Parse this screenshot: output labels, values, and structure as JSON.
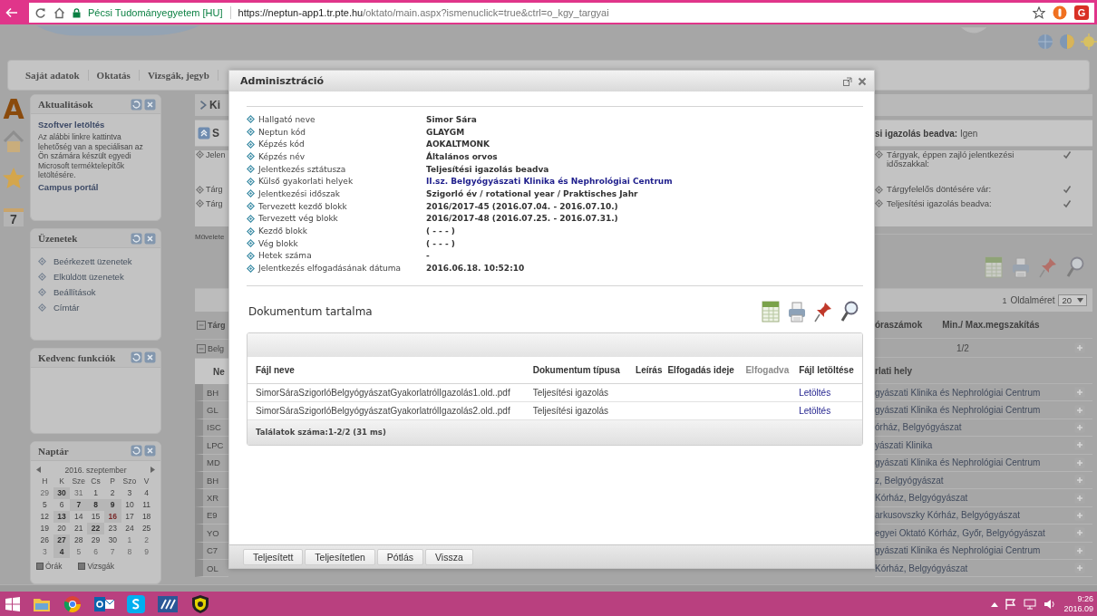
{
  "browser": {
    "site": "Pécsi Tudományegyetem [HU]",
    "url_host": "https://neptun-app1.tr.pte.hu",
    "url_path": "/oktato/main.aspx?ismenuclick=true&ctrl=o_kgy_targyai",
    "extension_letter": "G"
  },
  "nav_menu": [
    {
      "label": "Saját adatok"
    },
    {
      "label": "Oktatás"
    },
    {
      "label": "Vizsgák, jegyb"
    }
  ],
  "side_strip": {
    "logo_letter": "A",
    "calendar_day": "7"
  },
  "news_panel": {
    "title": "Aktualitások",
    "heading": "Szoftver letöltés",
    "text": "Az alábbi linkre kattintva lehetőség van a speciálisan az Ön számára készült egyedi Microsoft terméktelepítők letöltésére.",
    "link": "Campus portál"
  },
  "messages_panel": {
    "title": "Üzenetek",
    "items": [
      "Beérkezett üzenetek",
      "Elküldött üzenetek",
      "Beállítások",
      "Címtár"
    ]
  },
  "favorites_panel": {
    "title": "Kedvenc funkciók"
  },
  "calendar_panel": {
    "title": "Naptár",
    "month": "2016. szeptember",
    "weekdays": [
      "H",
      "K",
      "Sze",
      "Cs",
      "P",
      "Szo",
      "V"
    ],
    "weeks": [
      [
        {
          "day": "29",
          "muted": true,
          "bold": false,
          "today": false
        },
        {
          "day": "30",
          "muted": true,
          "bold": true,
          "today": false
        },
        {
          "day": "31",
          "muted": true,
          "bold": false,
          "today": false
        },
        {
          "day": "1",
          "muted": false,
          "bold": false,
          "today": false
        },
        {
          "day": "2",
          "muted": false,
          "bold": false,
          "today": false
        },
        {
          "day": "3",
          "muted": false,
          "bold": false,
          "today": false
        },
        {
          "day": "4",
          "muted": false,
          "bold": false,
          "today": false
        }
      ],
      [
        {
          "day": "5",
          "muted": false,
          "bold": false,
          "today": false
        },
        {
          "day": "6",
          "muted": false,
          "bold": false,
          "today": false
        },
        {
          "day": "7",
          "muted": false,
          "bold": true,
          "today": false
        },
        {
          "day": "8",
          "muted": false,
          "bold": true,
          "today": false
        },
        {
          "day": "9",
          "muted": false,
          "bold": true,
          "today": false
        },
        {
          "day": "10",
          "muted": false,
          "bold": false,
          "today": false
        },
        {
          "day": "11",
          "muted": false,
          "bold": false,
          "today": false
        }
      ],
      [
        {
          "day": "12",
          "muted": false,
          "bold": false,
          "today": false
        },
        {
          "day": "13",
          "muted": false,
          "bold": true,
          "today": false
        },
        {
          "day": "14",
          "muted": false,
          "bold": false,
          "today": false
        },
        {
          "day": "15",
          "muted": false,
          "bold": false,
          "today": false
        },
        {
          "day": "16",
          "muted": false,
          "bold": true,
          "today": true
        },
        {
          "day": "17",
          "muted": false,
          "bold": false,
          "today": false
        },
        {
          "day": "18",
          "muted": false,
          "bold": false,
          "today": false
        }
      ],
      [
        {
          "day": "19",
          "muted": false,
          "bold": false,
          "today": false
        },
        {
          "day": "20",
          "muted": false,
          "bold": false,
          "today": false
        },
        {
          "day": "21",
          "muted": false,
          "bold": false,
          "today": false
        },
        {
          "day": "22",
          "muted": false,
          "bold": true,
          "today": false
        },
        {
          "day": "23",
          "muted": false,
          "bold": false,
          "today": false
        },
        {
          "day": "24",
          "muted": false,
          "bold": false,
          "today": false
        },
        {
          "day": "25",
          "muted": false,
          "bold": false,
          "today": false
        }
      ],
      [
        {
          "day": "26",
          "muted": false,
          "bold": false,
          "today": false
        },
        {
          "day": "27",
          "muted": false,
          "bold": true,
          "today": false
        },
        {
          "day": "28",
          "muted": false,
          "bold": false,
          "today": false
        },
        {
          "day": "29",
          "muted": false,
          "bold": false,
          "today": false
        },
        {
          "day": "30",
          "muted": false,
          "bold": false,
          "today": false
        },
        {
          "day": "1",
          "muted": true,
          "bold": false,
          "today": false
        },
        {
          "day": "2",
          "muted": true,
          "bold": false,
          "today": false
        }
      ],
      [
        {
          "day": "3",
          "muted": true,
          "bold": false,
          "today": false
        },
        {
          "day": "4",
          "muted": true,
          "bold": true,
          "today": false
        },
        {
          "day": "5",
          "muted": true,
          "bold": false,
          "today": false
        },
        {
          "day": "6",
          "muted": true,
          "bold": false,
          "today": false
        },
        {
          "day": "7",
          "muted": true,
          "bold": false,
          "today": false
        },
        {
          "day": "8",
          "muted": true,
          "bold": false,
          "today": false
        },
        {
          "day": "9",
          "muted": true,
          "bold": false,
          "today": false
        }
      ]
    ],
    "filters": [
      {
        "label": "Órák",
        "checked": true
      },
      {
        "label": "Vizsgák",
        "checked": true
      }
    ]
  },
  "main": {
    "header_left": "Ki",
    "summary_left": "S",
    "summary_right": "**si igazolás beadva:** Igen",
    "checklist": [
      {
        "left": "Jelen",
        "label": "Tárgyak, éppen zajló jelentkezési időszakkal:",
        "checked": true
      },
      {
        "left": "Tárg",
        "label": "Tárgyfelelős döntésére vár:",
        "checked": true
      },
      {
        "left": "Tárg",
        "label": "Teljesítési igazolás beadva:",
        "checked": true
      }
    ],
    "operations_left": "Művelete",
    "page_number": "1",
    "page_size_label": "Oldalméret",
    "page_size": "20",
    "header_row": {
      "left": "Tárg",
      "columns": [
        "óraszámok",
        "Min./ Max.megszakítás"
      ]
    },
    "group_row": {
      "left": "Belg",
      "value": "1/2"
    },
    "sub_header": {
      "left": "Ne",
      "right": "rlati hely"
    },
    "rows": [
      {
        "code": "BH",
        "place": "gyászati Klinika és Nephrológiai Centrum"
      },
      {
        "code": "GL",
        "place": "gyászati Klinika és Nephrológiai Centrum"
      },
      {
        "code": "ISC",
        "place": "órház, Belgyógyászat"
      },
      {
        "code": "LPC",
        "place": "yászati Klinika"
      },
      {
        "code": "MD",
        "place": "gyászati Klinika és Nephrológiai Centrum"
      },
      {
        "code": "BH",
        "place": "z, Belgyógyászat"
      },
      {
        "code": "XR",
        "place": "Kórház, Belgyógyászat"
      },
      {
        "code": "E9",
        "place": "arkusovszky Kórház, Belgyógyászat"
      },
      {
        "code": "YO",
        "place": "egyei Oktató Kórház, Győr, Belgyógyászat"
      },
      {
        "code": "C7",
        "place": "gyászati Klinika és Nephrológiai Centrum"
      },
      {
        "code": "OL",
        "place": "Kórház, Belgyógyászat"
      }
    ]
  },
  "dialog": {
    "title": "Adminisztráció",
    "fields": [
      {
        "label": "Hallgató neve",
        "value": "Simor Sára",
        "kind": "text"
      },
      {
        "label": "Neptun kód",
        "value": "GLAYGM",
        "kind": "text"
      },
      {
        "label": "Képzés kód",
        "value": "AOKALTMONK",
        "kind": "text"
      },
      {
        "label": "Képzés név",
        "value": "Általános orvos",
        "kind": "text"
      },
      {
        "label": "Jelentkezés sztátusza",
        "value": "Teljesítési igazolás beadva",
        "kind": "text"
      },
      {
        "label": "Külső gyakorlati helyek",
        "value": "II.sz. Belgyógyászati Klinika és Nephrológiai Centrum",
        "kind": "link"
      },
      {
        "label": "Jelentkezési időszak",
        "value": "Szigorló év / rotational year / Praktisches Jahr",
        "kind": "text"
      },
      {
        "label": "Tervezett kezdő blokk",
        "value": "2016/2017-45 (2016.07.04. - 2016.07.10.)",
        "kind": "text"
      },
      {
        "label": "Tervezett vég blokk",
        "value": "2016/2017-48 (2016.07.25. - 2016.07.31.)",
        "kind": "text"
      },
      {
        "label": "Kezdő blokk",
        "value": "( - - - )",
        "kind": "text"
      },
      {
        "label": "Vég blokk",
        "value": "( - - - )",
        "kind": "text"
      },
      {
        "label": "Hetek száma",
        "value": "-",
        "kind": "text"
      },
      {
        "label": "Jelentkezés elfogadásának dátuma",
        "value": "2016.06.18. 10:52:10",
        "kind": "text"
      }
    ],
    "documents_title": "Dokumentum tartalma",
    "columns": [
      {
        "label": "Fájl neve",
        "dimmed": false
      },
      {
        "label": "Dokumentum típusa",
        "dimmed": false
      },
      {
        "label": "Leírás",
        "dimmed": false
      },
      {
        "label": "Elfogadás ideje",
        "dimmed": false
      },
      {
        "label": "Elfogadva",
        "dimmed": true
      },
      {
        "label": "Fájl letöltése",
        "dimmed": false
      }
    ],
    "rows": [
      {
        "file": "SimorSáraSzigorlóBelgyógyászatGyakorlatrólIgazolás1.old..pdf",
        "type": "Teljesítési igazolás",
        "download": "Letöltés"
      },
      {
        "file": "SimorSáraSzigorlóBelgyógyászatGyakorlatrólIgazolás2.old..pdf",
        "type": "Teljesítési igazolás",
        "download": "Letöltés"
      }
    ],
    "results": "Találatok száma:1-2/2 (31 ms)",
    "buttons": [
      "Teljesített",
      "Teljesítetlen",
      "Pótlás",
      "Vissza"
    ]
  },
  "taskbar": {
    "time": "9:26",
    "date": "2016.09"
  }
}
